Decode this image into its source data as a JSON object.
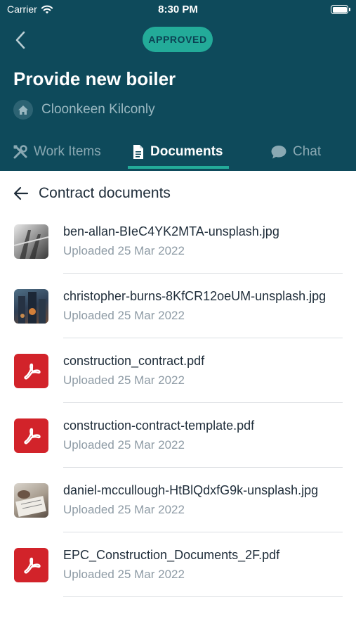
{
  "status_bar": {
    "carrier": "Carrier",
    "time": "8:30 PM",
    "wifi_icon": "wifi-icon",
    "battery_icon": "battery-icon"
  },
  "header": {
    "badge": "APPROVED",
    "title": "Provide new boiler",
    "location": "Cloonkeen Kilconly",
    "location_icon": "home-icon"
  },
  "tabs": [
    {
      "label": "Work Items",
      "icon": "tools-icon",
      "active": false
    },
    {
      "label": "Documents",
      "icon": "document-icon",
      "active": true
    },
    {
      "label": "Chat",
      "icon": "chat-icon",
      "active": false
    }
  ],
  "section": {
    "title": "Contract documents",
    "back_icon": "arrow-left-icon"
  },
  "documents": [
    {
      "name": "ben-allan-BIeC4YK2MTA-unsplash.jpg",
      "date": "Uploaded 25 Mar 2022",
      "type": "image"
    },
    {
      "name": "christopher-burns-8KfCR12oeUM-unsplash.jpg",
      "date": "Uploaded 25 Mar 2022",
      "type": "image"
    },
    {
      "name": "construction_contract.pdf",
      "date": "Uploaded 25 Mar 2022",
      "type": "pdf"
    },
    {
      "name": "construction-contract-template.pdf",
      "date": "Uploaded 25 Mar 2022",
      "type": "pdf"
    },
    {
      "name": "daniel-mccullough-HtBlQdxfG9k-unsplash.jpg",
      "date": "Uploaded 25 Mar 2022",
      "type": "image"
    },
    {
      "name": "EPC_Construction_Documents_2F.pdf",
      "date": "Uploaded 25 Mar 2022",
      "type": "pdf"
    }
  ],
  "colors": {
    "header_bg": "#0e4a5b",
    "accent": "#23ab99",
    "pdf_red": "#d2232a"
  }
}
